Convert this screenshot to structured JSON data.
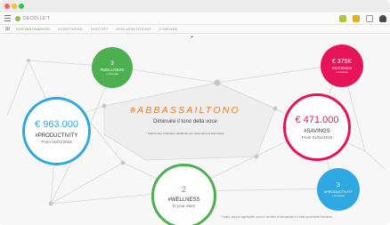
{
  "window": {
    "dots": [
      "#ff5f57",
      "#febc2e",
      "#28c840"
    ]
  },
  "appbar": {
    "brand": "DECOLLE'T",
    "right_icons": [
      {
        "name": "badge-icon",
        "color": "#b6c43a"
      },
      {
        "name": "badge-icon-2",
        "color": "#e0b020"
      },
      {
        "name": "box-icon",
        "color": "#9a9a9a"
      },
      {
        "name": "user-icon",
        "color": "#4a4a4a"
      }
    ]
  },
  "tabs": [
    {
      "label": "SOSTENTAMENTO",
      "active": true
    },
    {
      "label": "MONITORING",
      "active": false
    },
    {
      "label": "HISTORY",
      "active": false
    },
    {
      "label": "NEW MONITORING",
      "active": false
    },
    {
      "label": "COMPARE",
      "active": false
    }
  ],
  "hero": {
    "hashtag": "#ABBASSAILTONO",
    "subtitle": "Diminuire il tono della voce",
    "note": "* Selezionare l'indicatore desiderato per osservarne la descrizione"
  },
  "nodes": {
    "wellness_small": {
      "value": "3",
      "tag": "#WELLNESS",
      "sub": "+ Increase",
      "color": "#4caf50"
    },
    "savings_small": {
      "value": "€ 375K",
      "tag": "#SAVINGS",
      "sub": "+ Increase",
      "color": "#e8145a"
    },
    "productivity": {
      "value": "€ 963.000",
      "tag": "#PRODUCTIVITY",
      "sub": "From 01/01/2018",
      "color": "#2ea8e0"
    },
    "savings": {
      "value": "€ 471.000",
      "tag": "#SAVINGS",
      "sub": "From 01/01/2018",
      "color": "#e8145a"
    },
    "wellness": {
      "value": "2",
      "tag": "#WELLNESS",
      "sub": "In your room",
      "color": "#4caf50"
    },
    "productivity_small": {
      "value": "3",
      "tag": "#PRODUCTIVITY",
      "sub": "+ Increase",
      "color": "#2ea8e0"
    }
  },
  "footer": {
    "note": "* Valori, seppur significativi, sono in risultato di simulazioni e a titolo puramente indicativo."
  }
}
